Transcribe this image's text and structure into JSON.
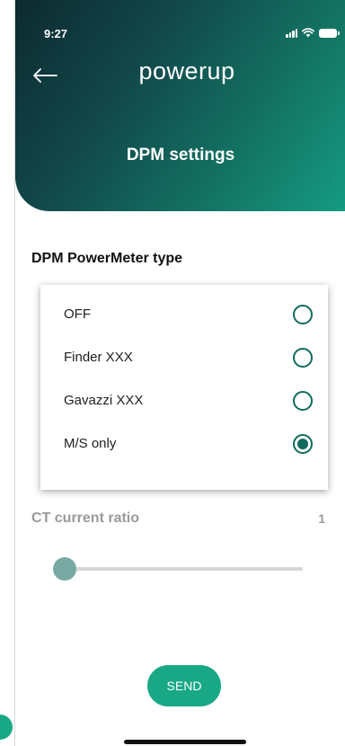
{
  "status_bar": {
    "time": "9:27"
  },
  "header": {
    "logo": "powerup",
    "title": "DPM settings"
  },
  "powermeter": {
    "section_title": "DPM PowerMeter type",
    "options": [
      {
        "label": "OFF",
        "checked": false
      },
      {
        "label": "Finder XXX",
        "checked": false
      },
      {
        "label": "Gavazzi XXX",
        "checked": false
      },
      {
        "label": "M/S only",
        "checked": true
      }
    ]
  },
  "ct_ratio": {
    "label": "CT current ratio",
    "value": "1",
    "slider_fraction": 0.0
  },
  "send_label": "SEND",
  "colors": {
    "accent": "#18a886",
    "radio": "#0f6b5c",
    "header_dark": "#0c2a2f",
    "header_light": "#159b82"
  }
}
